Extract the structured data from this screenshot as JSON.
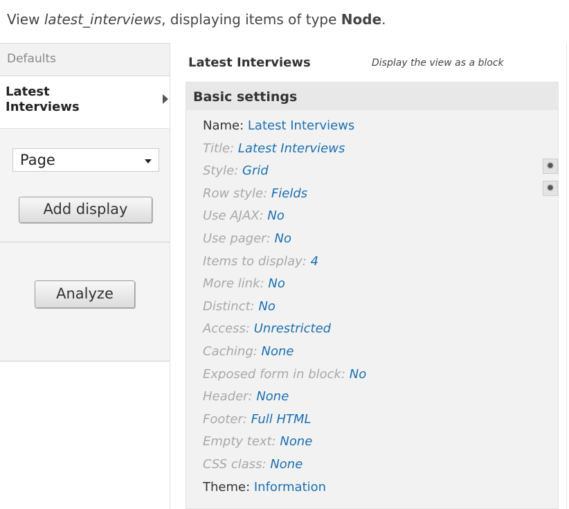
{
  "header": {
    "prefix": "View ",
    "view_name": "latest_interviews",
    "middle": ", displaying items of type ",
    "type": "Node",
    "suffix": "."
  },
  "tabs": {
    "defaults": "Defaults",
    "active": "Latest Interviews"
  },
  "display_select": {
    "value": "Page"
  },
  "buttons": {
    "add_display": "Add display",
    "analyze": "Analyze"
  },
  "display": {
    "title": "Latest Interviews",
    "description": "Display the view as a block"
  },
  "basic_settings": {
    "heading": "Basic settings",
    "rows": [
      {
        "label": "Name: ",
        "value": "Latest Interviews",
        "plain": true
      },
      {
        "label": "Title: ",
        "value": "Latest Interviews"
      },
      {
        "label": "Style: ",
        "value": "Grid"
      },
      {
        "label": "Row style: ",
        "value": "Fields"
      },
      {
        "label": "Use AJAX: ",
        "value": "No"
      },
      {
        "label": "Use pager: ",
        "value": "No"
      },
      {
        "label": "Items to display: ",
        "value": "4"
      },
      {
        "label": "More link: ",
        "value": "No"
      },
      {
        "label": "Distinct: ",
        "value": "No"
      },
      {
        "label": "Access: ",
        "value": "Unrestricted"
      },
      {
        "label": "Caching: ",
        "value": "None"
      },
      {
        "label": "Exposed form in block: ",
        "value": "No"
      },
      {
        "label": "Header: ",
        "value": "None"
      },
      {
        "label": "Footer: ",
        "value": "Full HTML"
      },
      {
        "label": "Empty text: ",
        "value": "None"
      },
      {
        "label": "CSS class: ",
        "value": "None"
      },
      {
        "label": "Theme: ",
        "value": "Information",
        "plain": true
      }
    ]
  },
  "icons": {
    "gear": "gear-icon",
    "arrow": "arrow-right-icon",
    "caret": "chevron-down-icon"
  },
  "colors": {
    "link": "#1a6fb0",
    "muted_label": "#a8a8a8"
  }
}
